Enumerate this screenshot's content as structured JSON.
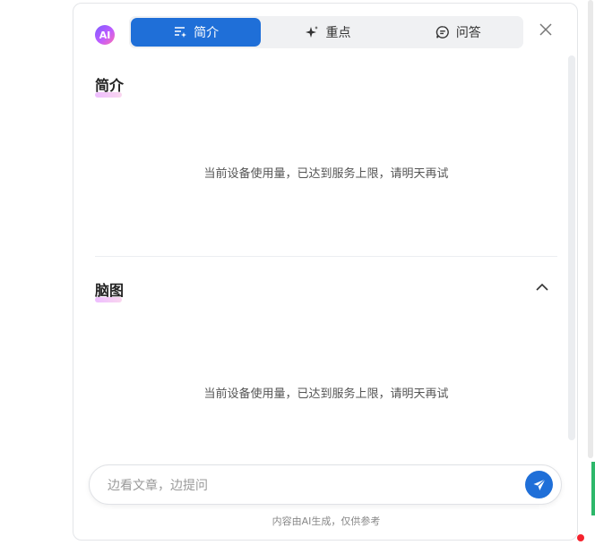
{
  "logo": {
    "text": "AI"
  },
  "tabs": [
    {
      "label": "简介",
      "icon": "summary-list-icon",
      "active": true
    },
    {
      "label": "重点",
      "icon": "sparkle-icon",
      "active": false
    },
    {
      "label": "问答",
      "icon": "chat-bubble-icon",
      "active": false
    }
  ],
  "sections": {
    "intro": {
      "title": "简介",
      "message": "当前设备使用量，已达到服务上限，请明天再试"
    },
    "mindmap": {
      "title": "脑图",
      "message": "当前设备使用量，已达到服务上限，请明天再试"
    }
  },
  "input": {
    "placeholder": "边看文章，边提问",
    "value": ""
  },
  "footer": {
    "note": "内容由AI生成，仅供参考"
  },
  "colors": {
    "accent": "#1f6fd8",
    "tab_bg": "#f0f1f3",
    "title_highlight": "#e6a1ff"
  }
}
